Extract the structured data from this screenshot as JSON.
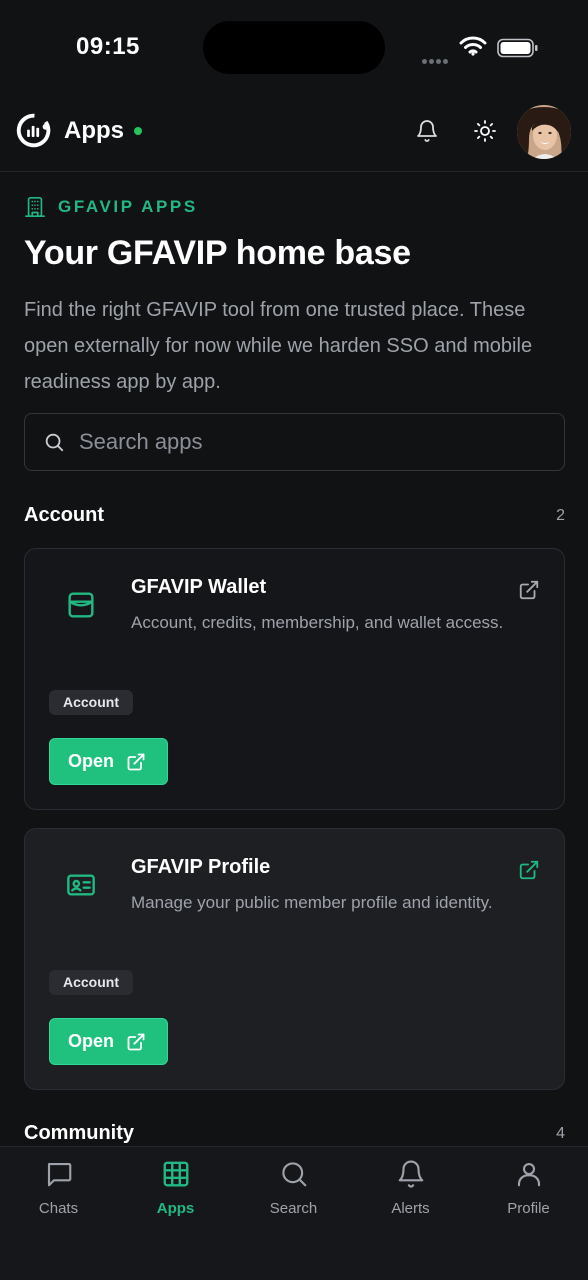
{
  "status_bar": {
    "time": "09:15"
  },
  "header": {
    "title": "Apps"
  },
  "hero": {
    "kicker": "GFAVIP APPS",
    "title": "Your GFAVIP home base",
    "description": "Find the right GFAVIP tool from one trusted place. These open externally for now while we harden SSO and mobile readiness app by app."
  },
  "search": {
    "placeholder": "Search apps",
    "value": ""
  },
  "sections": [
    {
      "title": "Account",
      "count": "2",
      "apps": [
        {
          "name": "GFAVIP Wallet",
          "description": "Account, credits, membership, and wallet access.",
          "tag": "Account",
          "open_label": "Open",
          "icon": "wallet-icon"
        },
        {
          "name": "GFAVIP Profile",
          "description": "Manage your public member profile and identity.",
          "tag": "Account",
          "open_label": "Open",
          "icon": "id-card-icon"
        }
      ]
    },
    {
      "title": "Community",
      "count": "4",
      "apps": []
    }
  ],
  "bottom_nav": [
    {
      "label": "Chats",
      "icon": "chat-icon",
      "active": false
    },
    {
      "label": "Apps",
      "icon": "apps-grid-icon",
      "active": true
    },
    {
      "label": "Search",
      "icon": "search-icon",
      "active": false
    },
    {
      "label": "Alerts",
      "icon": "bell-icon",
      "active": false
    },
    {
      "label": "Profile",
      "icon": "user-icon",
      "active": false
    }
  ],
  "colors": {
    "accent": "#22b882",
    "button": "#20c07f",
    "online": "#22c55e",
    "background": "#111214"
  }
}
